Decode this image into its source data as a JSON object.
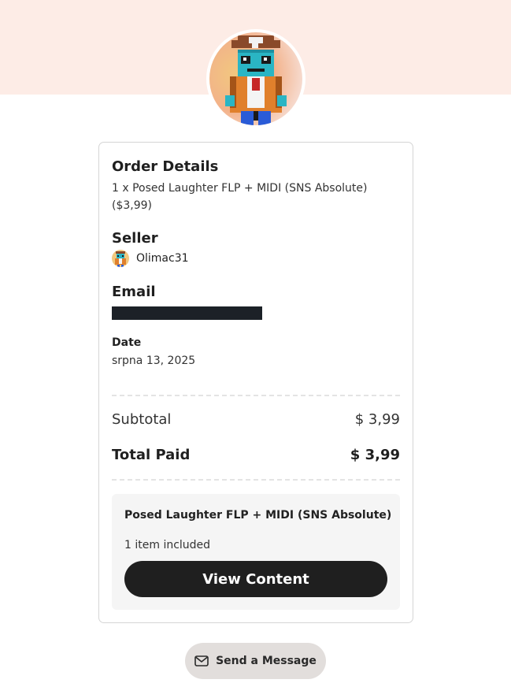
{
  "order": {
    "title": "Order Details",
    "line": "1 x Posed Laughter FLP + MIDI (SNS Absolute) ($3,99)"
  },
  "seller": {
    "title": "Seller",
    "name": "Olimac31",
    "avatar_icon": "pixel-art-avatar"
  },
  "email": {
    "title": "Email"
  },
  "date": {
    "title": "Date",
    "value": "srpna 13, 2025"
  },
  "totals": {
    "subtotal_label": "Subtotal",
    "subtotal_value": "$ 3,99",
    "total_label": "Total Paid",
    "total_value": "$ 3,99"
  },
  "content": {
    "product_name": "Posed Laughter FLP + MIDI (SNS Absolute)",
    "items_included": "1 item included",
    "view_button": "View Content"
  },
  "message_button": {
    "label": "Send a Message",
    "icon": "envelope-icon"
  },
  "colors": {
    "top_band": "#fdece6",
    "primary_button": "#1f1f1f",
    "secondary_button": "#e2dedc"
  }
}
